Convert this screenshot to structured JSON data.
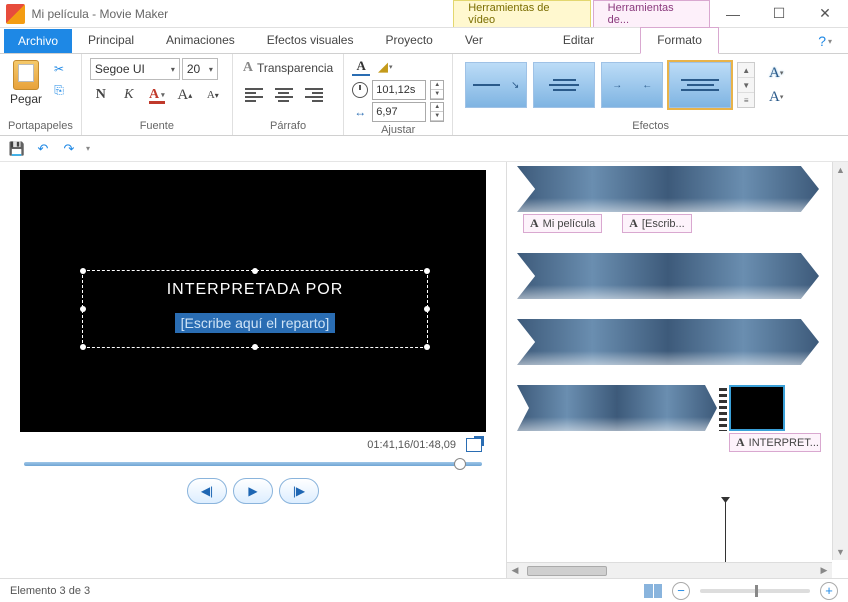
{
  "title": "Mi película - Movie Maker",
  "contextual_tabs": {
    "video": "Herramientas de vídeo",
    "text": "Herramientas de..."
  },
  "menu": {
    "file": "Archivo",
    "tabs": [
      "Principal",
      "Animaciones",
      "Efectos visuales",
      "Proyecto",
      "Ver",
      "Editar",
      "Formato"
    ]
  },
  "ribbon": {
    "clipboard": {
      "paste": "Pegar",
      "label": "Portapapeles"
    },
    "font": {
      "name": "Segoe UI",
      "size": "20",
      "label": "Fuente"
    },
    "paragraph": {
      "transparency": "Transparencia",
      "label": "Párrafo"
    },
    "adjust": {
      "start_time": "101,12s",
      "duration": "6,97",
      "label": "Ajustar"
    },
    "effects": {
      "label": "Efectos"
    }
  },
  "preview": {
    "line1": "INTERPRETADA POR",
    "line2": "[Escribe aquí el reparto]",
    "time": "01:41,16/01:48,09"
  },
  "timeline": {
    "label1": "Mi película",
    "label2": "[Escrib...",
    "label3": "INTERPRET..."
  },
  "status": {
    "left": "Elemento 3 de 3"
  }
}
